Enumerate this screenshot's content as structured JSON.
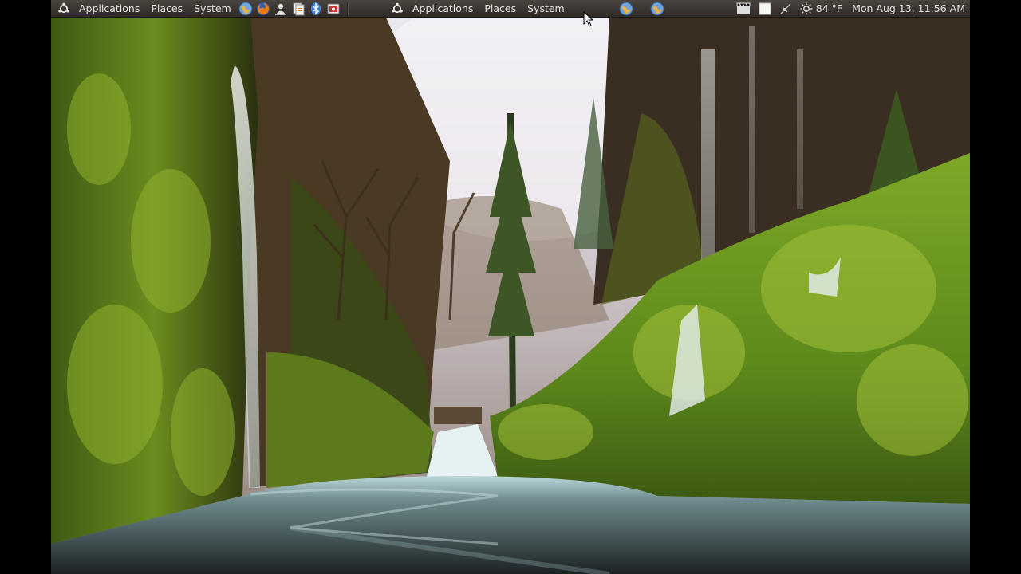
{
  "panel_left": {
    "applications": "Applications",
    "places": "Places",
    "system": "System"
  },
  "launchers": [
    {
      "name": "network-globe-icon"
    },
    {
      "name": "firefox-icon"
    },
    {
      "name": "user-switch-icon"
    },
    {
      "name": "files-icon"
    },
    {
      "name": "bluetooth-icon"
    },
    {
      "name": "screenshot-icon"
    }
  ],
  "panel_mid": {
    "applications": "Applications",
    "places": "Places",
    "system": "System"
  },
  "tray": {
    "weather": "84 °F",
    "clock": "Mon Aug 13, 11:56 AM"
  },
  "colors": {
    "panel": "#3a3430",
    "moss": "#5e8a1c",
    "water": "#b9d6d8"
  }
}
